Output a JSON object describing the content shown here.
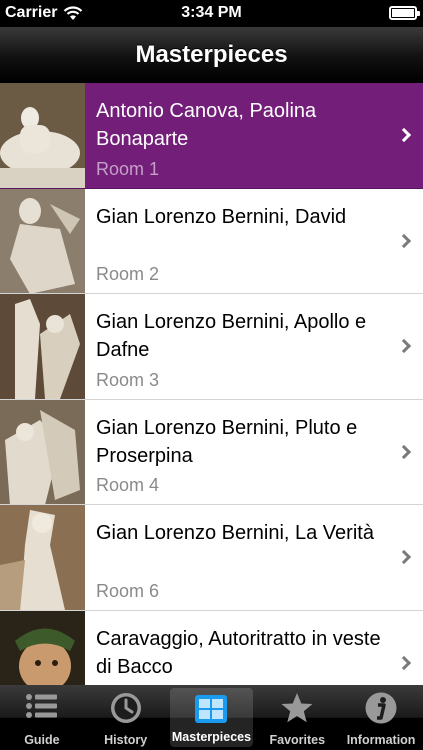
{
  "status_bar": {
    "carrier": "Carrier",
    "time": "3:34 PM"
  },
  "nav": {
    "title": "Masterpieces"
  },
  "items": [
    {
      "title": "Antonio Canova, Paolina Bonaparte",
      "room": "Room 1",
      "selected": true
    },
    {
      "title": "Gian Lorenzo Bernini, David",
      "room": "Room 2",
      "selected": false
    },
    {
      "title": "Gian Lorenzo Bernini, Apollo e Dafne",
      "room": "Room 3",
      "selected": false
    },
    {
      "title": "Gian Lorenzo Bernini, Pluto e Proserpina",
      "room": "Room 4",
      "selected": false
    },
    {
      "title": "Gian Lorenzo Bernini, La Verità",
      "room": "Room 6",
      "selected": false
    },
    {
      "title": "Caravaggio, Autoritratto in veste di Bacco",
      "room": "",
      "selected": false
    }
  ],
  "tabs": [
    {
      "label": "Guide",
      "icon": "list-icon",
      "active": false
    },
    {
      "label": "History",
      "icon": "clock-icon",
      "active": false
    },
    {
      "label": "Masterpieces",
      "icon": "grid-icon",
      "active": true
    },
    {
      "label": "Favorites",
      "icon": "star-icon",
      "active": false
    },
    {
      "label": "Information",
      "icon": "info-icon",
      "active": false
    }
  ],
  "colors": {
    "selected_row": "#731f79",
    "nav_bar": "#111111"
  }
}
